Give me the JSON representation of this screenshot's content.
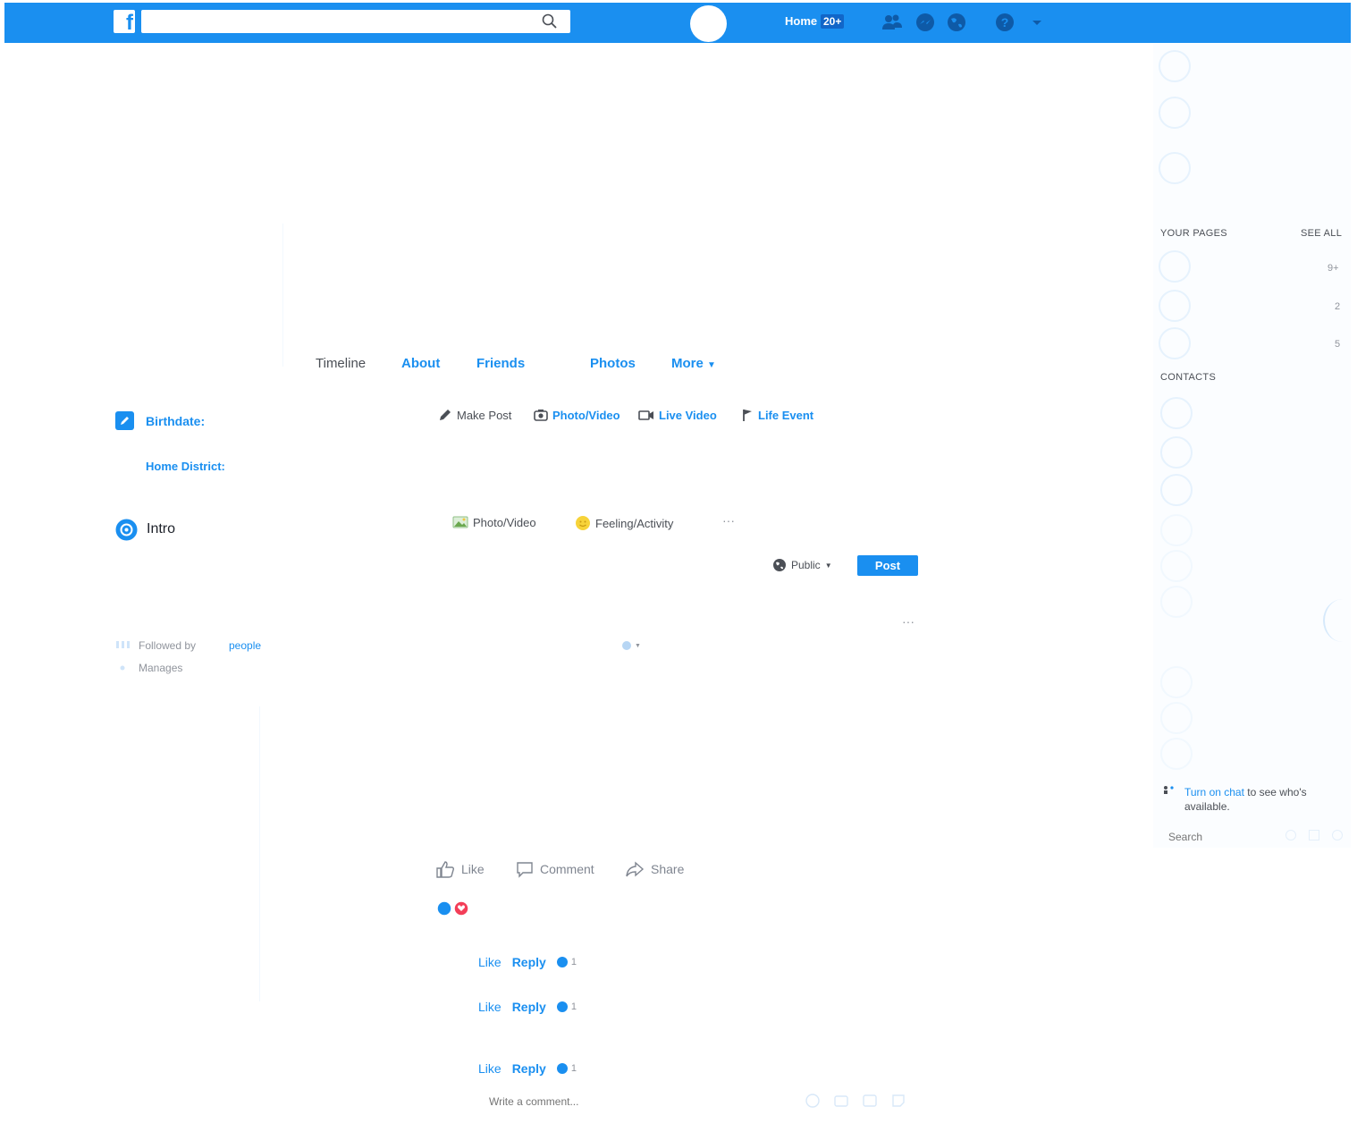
{
  "topbar": {
    "logo_letter": "f",
    "search_placeholder": "",
    "home_label": "Home",
    "home_badge": "20+"
  },
  "profile_nav": {
    "tabs": [
      {
        "label": "Timeline"
      },
      {
        "label": "About"
      },
      {
        "label": "Friends"
      },
      {
        "label": "Photos"
      },
      {
        "label": "More"
      }
    ]
  },
  "left": {
    "birthdate_label": "Birthdate:",
    "home_district_label": "Home District:",
    "intro_label": "Intro",
    "followed_by_label": "Followed by",
    "followed_by_value": "people",
    "manages_label": "Manages"
  },
  "composer": {
    "tabs": [
      "Make Post",
      "Photo/Video",
      "Live Video",
      "Life Event"
    ],
    "options": [
      "Photo/Video",
      "Feeling/Activity"
    ],
    "more": "···",
    "privacy": "Public",
    "post_button": "Post"
  },
  "post": {
    "menu": "···",
    "actions": [
      "Like",
      "Comment",
      "Share"
    ]
  },
  "comments": [
    {
      "like": "Like",
      "reply": "Reply",
      "reactions": "1"
    },
    {
      "like": "Like",
      "reply": "Reply",
      "reactions": "1"
    },
    {
      "like": "Like",
      "reply": "Reply",
      "reactions": "1"
    }
  ],
  "comment_input": {
    "placeholder": "Write a comment..."
  },
  "sidebar": {
    "your_pages": "YOUR PAGES",
    "see_all": "SEE ALL",
    "page_counts": [
      "9+",
      "2",
      "5"
    ],
    "contacts": "CONTACTS",
    "turn_on_chat_link": "Turn on chat",
    "turn_on_chat_rest": "to see who's available.",
    "search_placeholder": "Search"
  },
  "colors": {
    "brand": "#1a8ff0",
    "text": "#4b4f56",
    "muted": "#90949c",
    "heart": "#f33e58"
  }
}
